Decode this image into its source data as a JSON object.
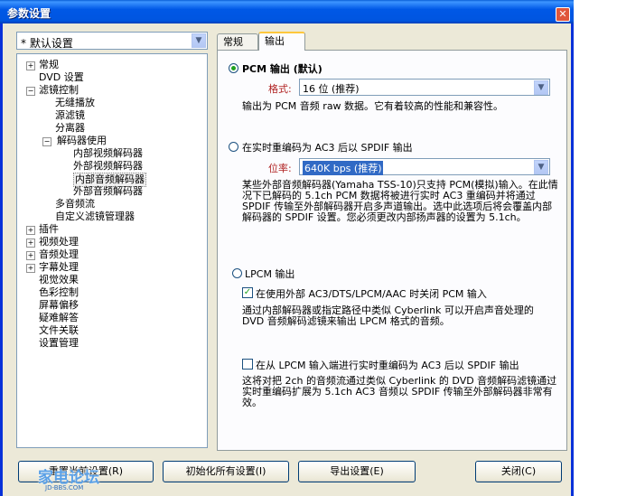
{
  "window": {
    "title": "参数设置",
    "close_glyph": "✕"
  },
  "preset": {
    "value": "* 默认设置"
  },
  "tree": [
    {
      "label": "常规",
      "expander": "+"
    },
    {
      "label": "DVD 设置"
    },
    {
      "label": "滤镜控制",
      "expander": "−"
    },
    {
      "label": "无缝播放"
    },
    {
      "label": "源滤镜"
    },
    {
      "label": "分离器"
    },
    {
      "label": "解码器使用",
      "expander": "−"
    },
    {
      "label": "内部视频解码器"
    },
    {
      "label": "外部视频解码器"
    },
    {
      "label": "内部音频解码器"
    },
    {
      "label": "外部音频解码器"
    },
    {
      "label": "多音频流"
    },
    {
      "label": "自定义滤镜管理器"
    },
    {
      "label": "插件",
      "expander": "+"
    },
    {
      "label": "视频处理",
      "expander": "+"
    },
    {
      "label": "音频处理",
      "expander": "+"
    },
    {
      "label": "字幕处理",
      "expander": "+"
    },
    {
      "label": "视觉效果"
    },
    {
      "label": "色彩控制"
    },
    {
      "label": "屏幕偏移"
    },
    {
      "label": "疑难解答"
    },
    {
      "label": "文件关联"
    },
    {
      "label": "设置管理"
    }
  ],
  "tabs": [
    {
      "label": "常规"
    },
    {
      "label": "输出"
    }
  ],
  "pcm": {
    "radio_label": "PCM 输出 (默认)",
    "format_label": "格式:",
    "format_value": "16 位 (推荐)",
    "desc": "输出为 PCM 音频 raw 数据。它有着较高的性能和兼容性。"
  },
  "ac3": {
    "radio_label": "在实时重编码为 AC3 后以 SPDIF 输出",
    "bitrate_label": "位率:",
    "bitrate_value": "640K bps (推荐)",
    "desc": "某些外部音频解码器(Yamaha TSS-10)只支持 PCM(模拟)输入。在此情况下已解码的 5.1ch PCM 数据将被进行实时 AC3 重编码并将通过 SPDIF 传输至外部解码器开启多声道输出。选中此选项后将会覆盖内部解码器的 SPDIF 设置。您必须更改内部扬声器的设置为 5.1ch。"
  },
  "lpcm": {
    "radio_label": "LPCM 输出",
    "check_label": "在使用外部 AC3/DTS/LPCM/AAC 时关闭 PCM 输入",
    "check_desc": "通过内部解码器或指定路径中类似 Cyberlink 可以开启声音处理的 DVD 音频解码滤镜来输出 LPCM 格式的音频。"
  },
  "reencode": {
    "check_label": "在从 LPCM 输入端进行实时重编码为 AC3 后以 SPDIF 输出",
    "desc": "这将对把 2ch 的音频流通过类似 Cyberlink 的 DVD 音频解码滤镜通过实时重编码扩展为 5.1ch AC3 音频以 SPDIF 传输至外部解码器非常有效。"
  },
  "buttons": {
    "reset_current": "重置当前设置(R)",
    "init_all": "初始化所有设置(I)",
    "export": "导出设置(E)",
    "close": "关闭(C)"
  },
  "watermark": {
    "text": "家电论坛",
    "sub": "JD-BBS.COM"
  },
  "state": {
    "pcm_selected": true,
    "lpcm_check_checked": true,
    "reencode_checked": false,
    "selected_tree_item": "内部音频解码器",
    "active_tab": "输出"
  },
  "colors": {
    "title_blue": "#0058e6",
    "accent_orange": "#ffc83c",
    "selection_blue": "#316ac5"
  }
}
